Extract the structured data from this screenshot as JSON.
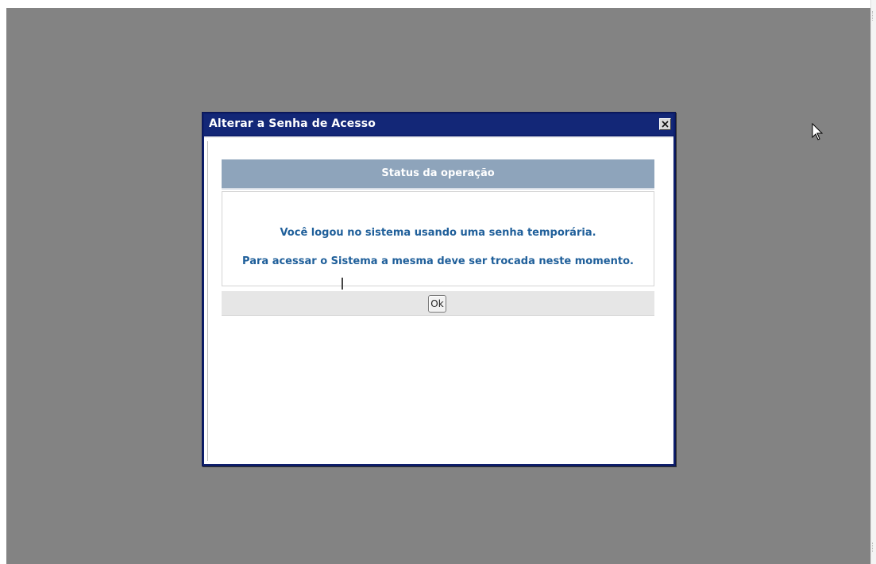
{
  "dialog": {
    "title": "Alterar a Senha de Acesso",
    "close_icon": "close-icon"
  },
  "status": {
    "header": "Status da operação",
    "message_line1": "Você logou no sistema usando uma senha temporária.",
    "message_line2": "Para acessar o Sistema a mesma deve ser trocada neste momento."
  },
  "actions": {
    "ok_label": "Ok"
  },
  "colors": {
    "overlay": "#838383",
    "titlebar": "#132777",
    "status_header_bg": "#8ea4bb",
    "message_text": "#1f5f9a"
  },
  "cursor_icon": "mouse-pointer-icon"
}
